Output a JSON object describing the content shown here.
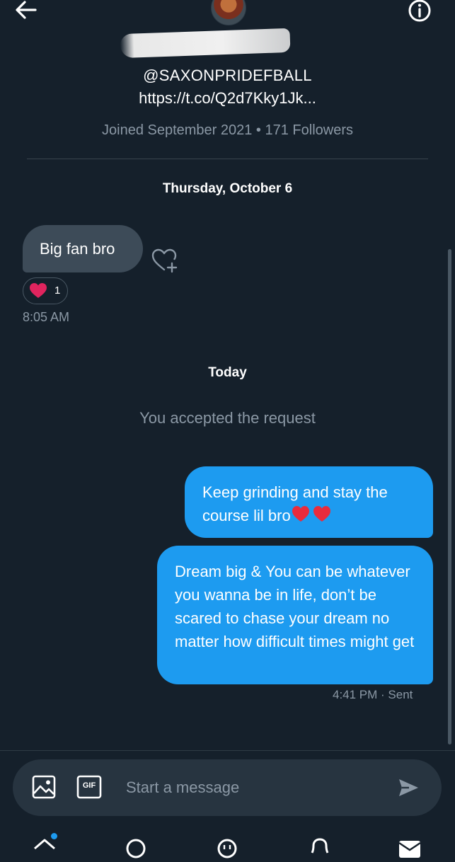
{
  "header": {
    "handle": "@SAXONPRIDEFBALL",
    "url": "https://t.co/Q2d7Kky1Jk...",
    "joined": "Joined September 2021 • 171 Followers",
    "back_icon": "arrow-left-icon",
    "info_icon": "info-icon"
  },
  "conversation": {
    "date_label_1": "Thursday, October 6",
    "received": {
      "text": "Big fan bro",
      "reaction_count": "1",
      "time": "8:05 AM"
    },
    "date_label_2": "Today",
    "system_notice": "You accepted the request",
    "sent": [
      {
        "text": "Keep grinding and stay the course lil bro"
      },
      {
        "text": "Dream big & You can be whatever you wanna be in life, don’t be scared to chase your dream no matter how difficult times might get"
      }
    ],
    "sent_time": "4:41 PM",
    "sent_status": "· Sent"
  },
  "composer": {
    "placeholder": "Start a message",
    "gif_label": "GIF"
  },
  "colors": {
    "background": "#15202b",
    "accent": "#1d9bf0",
    "received_bubble": "#3d4b58",
    "muted_text": "#8b98a5",
    "heart": "#e0245e"
  }
}
